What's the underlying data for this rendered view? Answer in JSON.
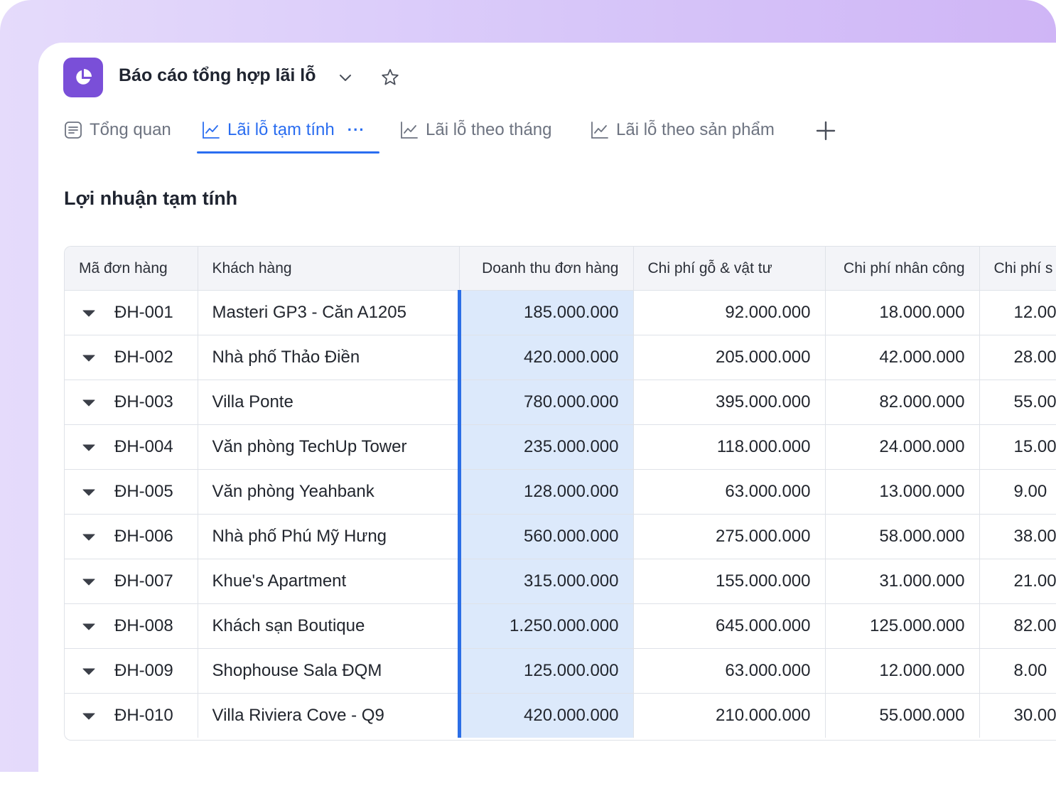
{
  "header": {
    "title": "Báo cáo tổng hợp lãi lỗ"
  },
  "tabs": [
    {
      "label": "Tổng quan",
      "icon": "document-icon",
      "active": false
    },
    {
      "label": "Lãi lỗ tạm tính",
      "icon": "line-chart-icon",
      "active": true,
      "more": "···"
    },
    {
      "label": "Lãi lỗ theo tháng",
      "icon": "line-chart-icon",
      "active": false
    },
    {
      "label": "Lãi lỗ theo sản phẩm",
      "icon": "line-chart-icon",
      "active": false
    }
  ],
  "section": {
    "title": "Lợi nhuận tạm tính"
  },
  "table": {
    "columns": [
      "Mã đơn hàng",
      "Khách hàng",
      "Doanh thu đơn hàng",
      "Chi phí gỗ & vật tư",
      "Chi phí nhân công",
      "Chi phí s"
    ],
    "rows": [
      [
        "ĐH-001",
        "Masteri GP3 - Căn A1205",
        "185.000.000",
        "92.000.000",
        "18.000.000",
        "12.00"
      ],
      [
        "ĐH-002",
        "Nhà phố Thảo Điền",
        "420.000.000",
        "205.000.000",
        "42.000.000",
        "28.00"
      ],
      [
        "ĐH-003",
        "Villa Ponte",
        "780.000.000",
        "395.000.000",
        "82.000.000",
        "55.00"
      ],
      [
        "ĐH-004",
        "Văn phòng TechUp Tower",
        "235.000.000",
        "118.000.000",
        "24.000.000",
        "15.00"
      ],
      [
        "ĐH-005",
        "Văn phòng Yeahbank",
        "128.000.000",
        "63.000.000",
        "13.000.000",
        "9.00"
      ],
      [
        "ĐH-006",
        "Nhà phố Phú Mỹ Hưng",
        "560.000.000",
        "275.000.000",
        "58.000.000",
        "38.00"
      ],
      [
        "ĐH-007",
        "Khue's Apartment",
        "315.000.000",
        "155.000.000",
        "31.000.000",
        "21.00"
      ],
      [
        "ĐH-008",
        "Khách sạn Boutique",
        "1.250.000.000",
        "645.000.000",
        "125.000.000",
        "82.00"
      ],
      [
        "ĐH-009",
        "Shophouse Sala ĐQM",
        "125.000.000",
        "63.000.000",
        "12.000.000",
        "8.00"
      ],
      [
        "ĐH-010",
        "Villa Riviera Cove - Q9",
        "420.000.000",
        "210.000.000",
        "55.000.000",
        "30.00"
      ]
    ]
  },
  "colors": {
    "accent": "#2a6df0",
    "brand": "#7a4fd8",
    "highlight": "#dce9fb"
  }
}
